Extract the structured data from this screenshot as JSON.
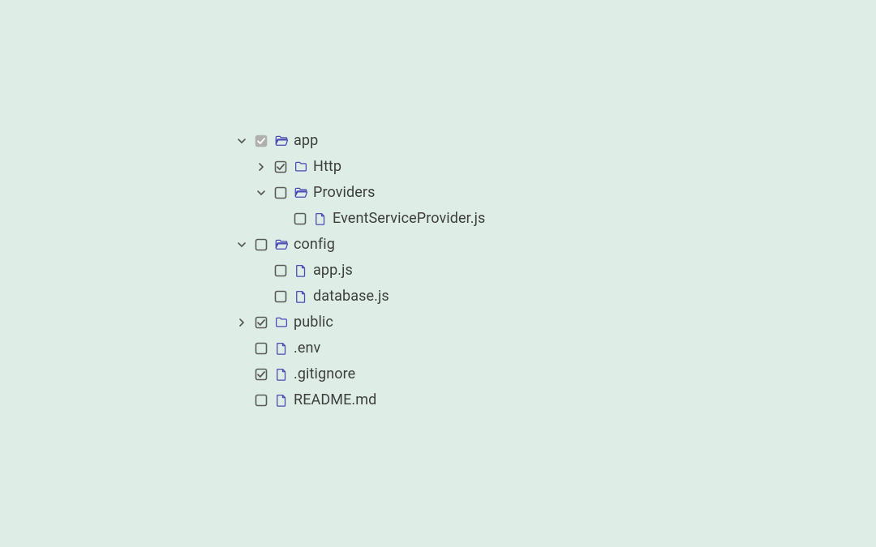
{
  "colors": {
    "background": "#deeee7",
    "iconBlue": "#4a4bb5",
    "checkGray": "#5a5a5a",
    "checkFill": "#b0b0b0",
    "text": "#3e3e3e"
  },
  "nodes": [
    {
      "depth": 0,
      "toggle": "open",
      "check": "indeterminate",
      "kind": "folder-open",
      "label": "app"
    },
    {
      "depth": 1,
      "toggle": "closed",
      "check": "checked",
      "kind": "folder-closed",
      "label": "Http"
    },
    {
      "depth": 1,
      "toggle": "open",
      "check": "unchecked",
      "kind": "folder-open",
      "label": "Providers"
    },
    {
      "depth": 2,
      "toggle": "none",
      "check": "unchecked",
      "kind": "file",
      "label": "EventServiceProvider.js"
    },
    {
      "depth": 0,
      "toggle": "open",
      "check": "unchecked",
      "kind": "folder-open",
      "label": "config"
    },
    {
      "depth": 1,
      "toggle": "none",
      "check": "unchecked",
      "kind": "file",
      "label": "app.js"
    },
    {
      "depth": 1,
      "toggle": "none",
      "check": "unchecked",
      "kind": "file",
      "label": "database.js"
    },
    {
      "depth": 0,
      "toggle": "closed",
      "check": "checked",
      "kind": "folder-closed",
      "label": "public"
    },
    {
      "depth": 0,
      "toggle": "none",
      "check": "unchecked",
      "kind": "file",
      "label": ".env"
    },
    {
      "depth": 0,
      "toggle": "none",
      "check": "checked",
      "kind": "file",
      "label": ".gitignore"
    },
    {
      "depth": 0,
      "toggle": "none",
      "check": "unchecked",
      "kind": "file",
      "label": "README.md"
    }
  ]
}
